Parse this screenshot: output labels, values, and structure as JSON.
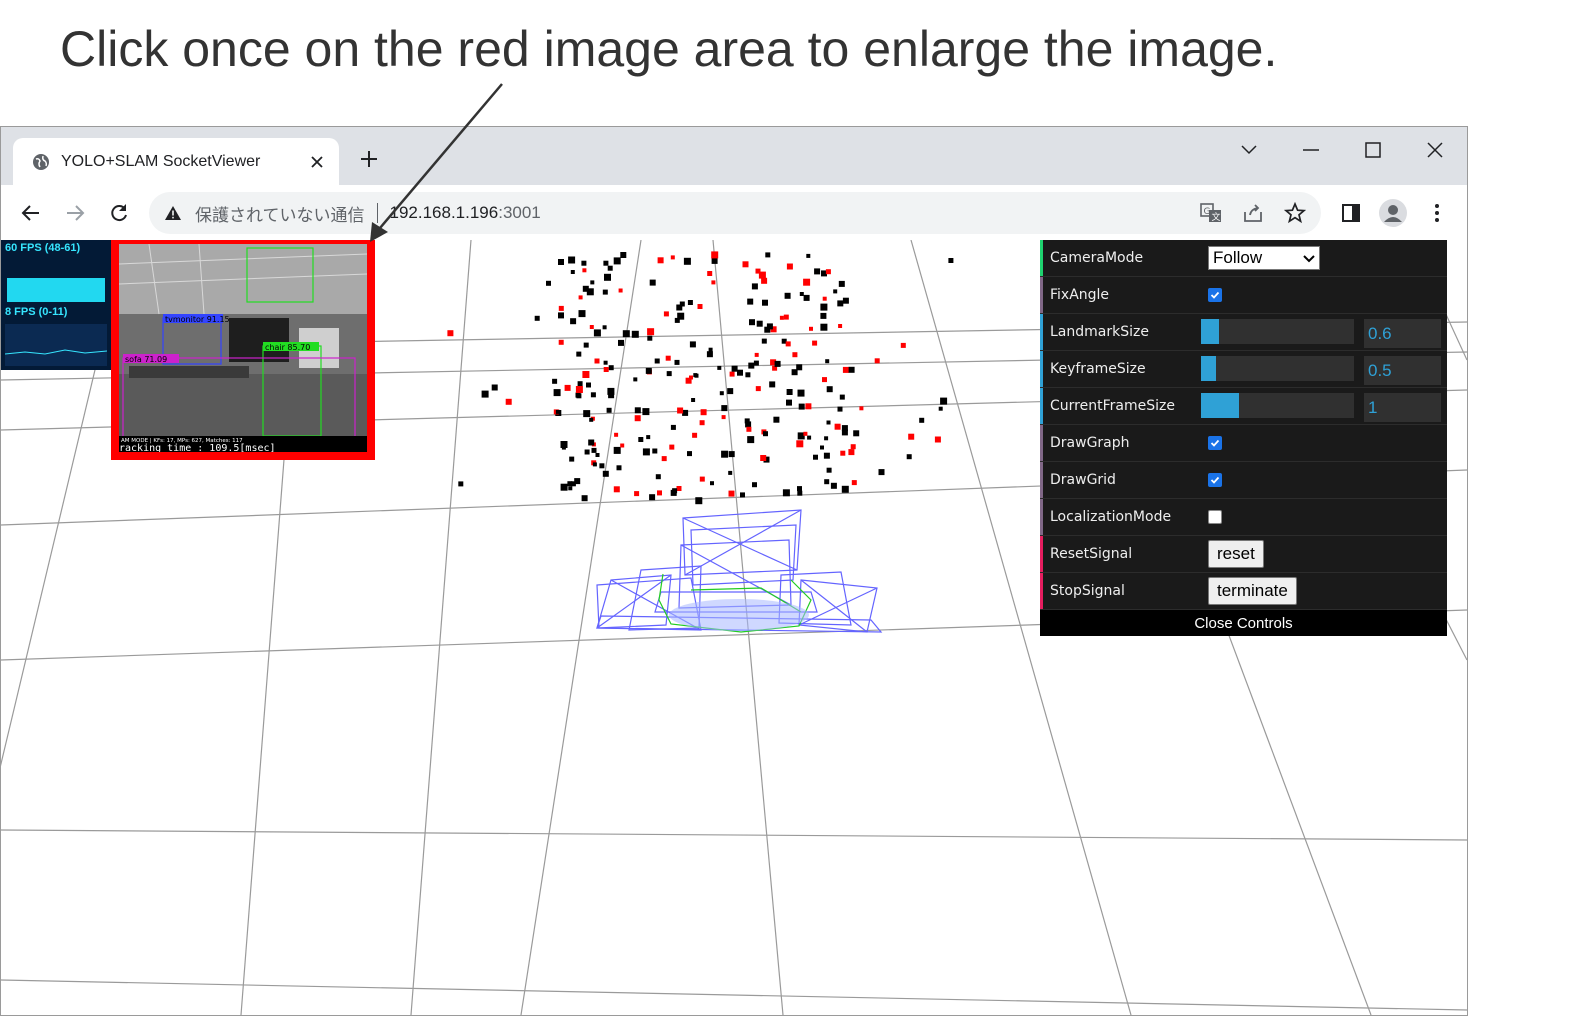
{
  "caption": "Click once on the red image area to enlarge the image.",
  "browser": {
    "tab_title": "YOLO+SLAM SocketViewer",
    "address_security": "保護されていない通信",
    "address_host": "192.168.1.196",
    "address_port": ":3001"
  },
  "stats": {
    "fps_label": "60 FPS (48-61)",
    "ms_label": "8 FPS (0-11)"
  },
  "camera_overlay": {
    "labels": [
      "tvmonitor 91.15",
      "chair 85.70",
      "sofa 71.09"
    ],
    "status_line": "AM MODE | KFs: 17, MPs: 627, Matches: 117",
    "tracking_line": "racking time : 109.5[msec]"
  },
  "controls": {
    "camera_mode": {
      "label": "CameraMode",
      "value": "Follow"
    },
    "fix_angle": {
      "label": "FixAngle",
      "checked": true
    },
    "landmark_size": {
      "label": "LandmarkSize",
      "value": "0.6",
      "fraction": 0.12
    },
    "keyframe_size": {
      "label": "KeyframeSize",
      "value": "0.5",
      "fraction": 0.1
    },
    "current_frame_size": {
      "label": "CurrentFrameSize",
      "value": "1",
      "fraction": 0.25
    },
    "draw_graph": {
      "label": "DrawGraph",
      "checked": true
    },
    "draw_grid": {
      "label": "DrawGrid",
      "checked": true
    },
    "localization_mode": {
      "label": "LocalizationMode",
      "checked": false
    },
    "reset_signal": {
      "label": "ResetSignal",
      "button": "reset"
    },
    "stop_signal": {
      "label": "StopSignal",
      "button": "terminate"
    },
    "close_controls": "Close Controls"
  },
  "colors": {
    "accent_blue": "#2fa1d6",
    "highlight_red": "#ff0000",
    "keyframe_blue": "#6464ff"
  }
}
